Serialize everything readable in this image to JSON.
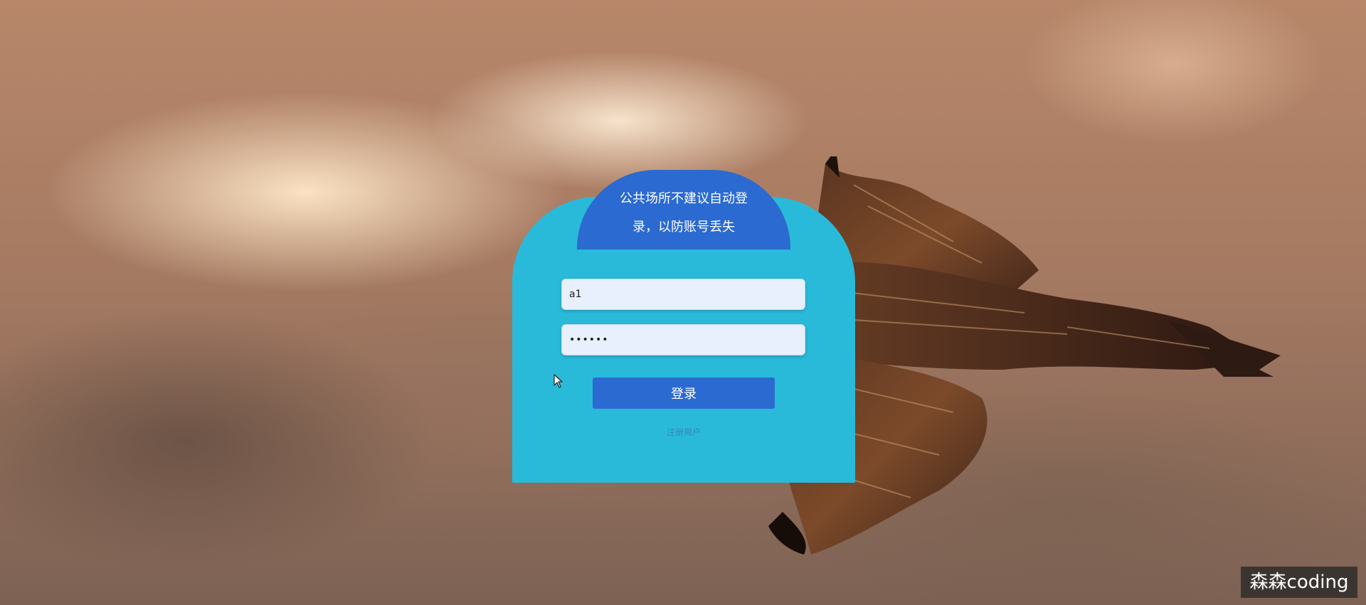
{
  "login": {
    "notice": "公共场所不建议自动登录，以防账号丢失",
    "username_value": "a1",
    "password_value": "aaaaaa",
    "login_label": "登录",
    "register_label": "注册用户"
  },
  "watermark": "森森coding",
  "colors": {
    "card": "#29bad9",
    "header": "#2b6ad0",
    "button": "#2b6ad0",
    "input_bg": "#e8f0fe"
  },
  "icons": {
    "cursor": "mouse-pointer-icon"
  }
}
